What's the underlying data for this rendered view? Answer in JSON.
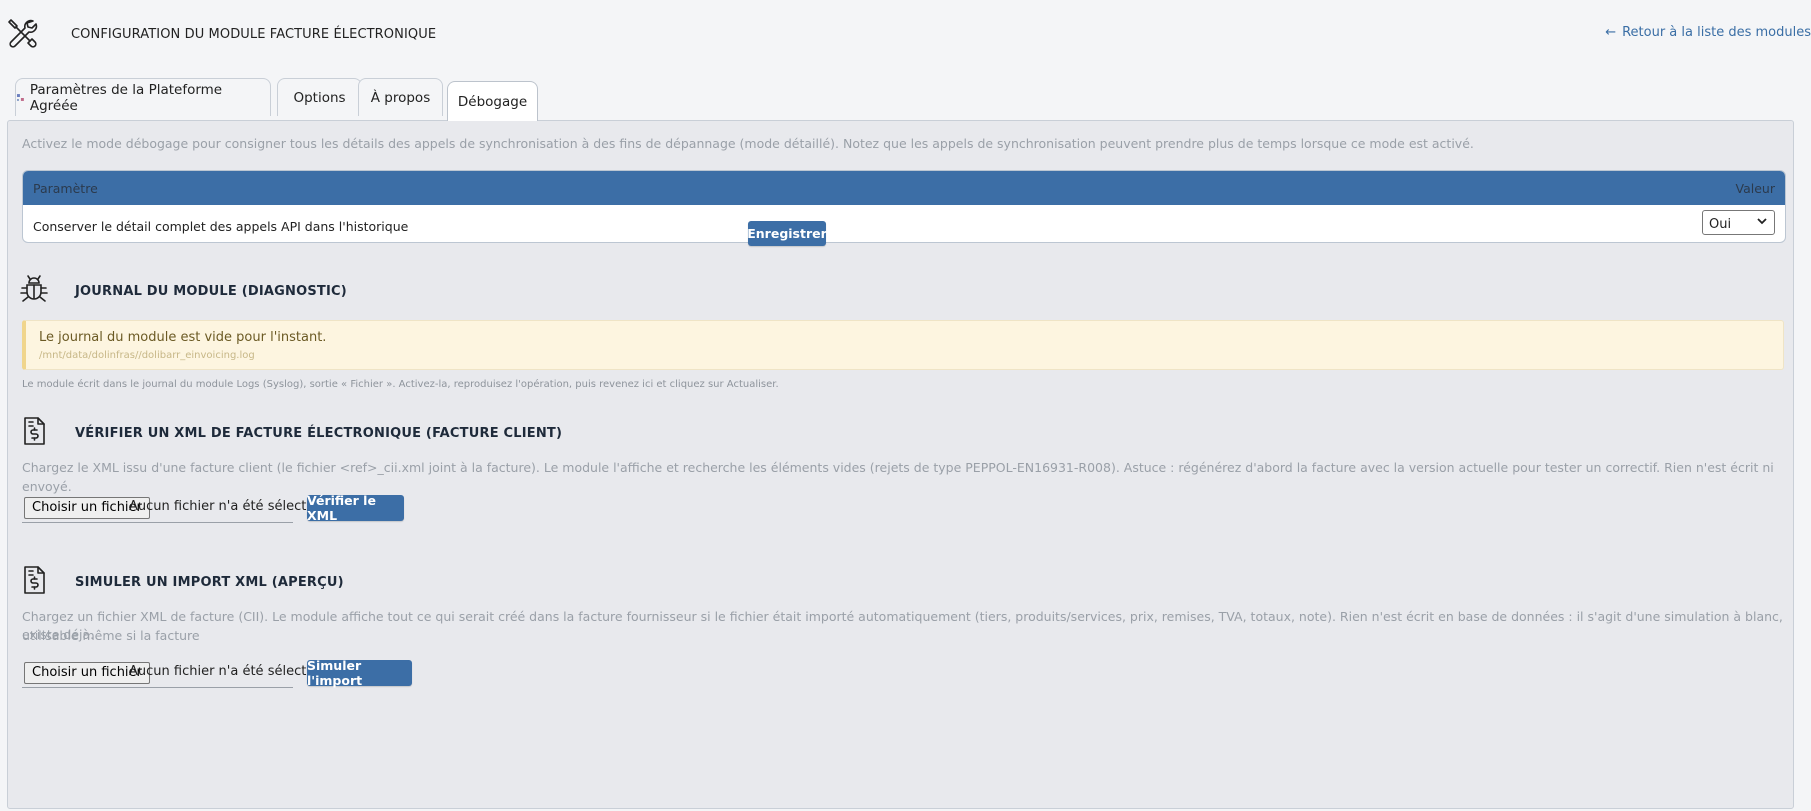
{
  "header": {
    "title": "CONFIGURATION DU MODULE FACTURE ÉLECTRONIQUE",
    "back_link": "Retour à la liste des modules"
  },
  "tabs": [
    {
      "label": "Paramètres de la Plateforme Agréée",
      "active": false
    },
    {
      "label": "Options",
      "active": false
    },
    {
      "label": "À propos",
      "active": false
    },
    {
      "label": "Débogage",
      "active": true
    }
  ],
  "debug": {
    "intro": "Activez le mode débogage pour consigner tous les détails des appels de synchronisation à des fins de dépannage (mode détaillé). Notez que les appels de synchronisation peuvent prendre plus de temps lorsque ce mode est activé.",
    "table": {
      "col_param": "Paramètre",
      "col_value": "Valeur",
      "rows": [
        {
          "label": "Conserver le détail complet des appels API dans l'historique",
          "value": "Oui"
        }
      ]
    },
    "save_label": "Enregistrer"
  },
  "journal": {
    "title": "JOURNAL DU MODULE (DIAGNOSTIC)",
    "empty_msg": "Le journal du module est vide pour l'instant.",
    "path": "/mnt/data/dolinfras//dolibarr_einvoicing.log",
    "note": "Le module écrit dans le journal du module Logs (Syslog), sortie « Fichier ». Activez-la, reproduisez l'opération, puis revenez ici et cliquez sur Actualiser."
  },
  "verify": {
    "title": "VÉRIFIER UN XML DE FACTURE ÉLECTRONIQUE (FACTURE CLIENT)",
    "desc": "Chargez le XML issu d'une facture client (le fichier <ref>_cii.xml joint à la facture). Le module l'affiche et recherche les éléments vides (rejets de type PEPPOL-EN16931-R008). Astuce : régénérez d'abord la facture avec la version actuelle pour tester un correctif. Rien n'est écrit ni envoyé.",
    "file_button": "Choisir un fichier",
    "file_status": "Aucun fichier n'a été sélectionné",
    "submit_label": "Vérifier le XML"
  },
  "simulate": {
    "title": "SIMULER UN IMPORT XML (APERÇU)",
    "desc_line1": "Chargez un fichier XML de facture (CII). Le module affiche tout ce qui serait créé dans la facture fournisseur si le fichier était importé automatiquement (tiers, produits/services, prix, remises, TVA, totaux, note). Rien n'est écrit en base de données : il s'agit d'une simulation à blanc, utilisable même si la facture",
    "desc_line2": "existe déjà.",
    "file_button": "Choisir un fichier",
    "file_status": "Aucun fichier n'a été sélectionné",
    "submit_label": "Simuler l'import"
  },
  "colors": {
    "accent": "#3c6ea6",
    "panel_bg": "#e8e9ed",
    "notice_bg": "#fdf5e0"
  },
  "icons": {
    "header": "tools-icon",
    "back": "arrow-left-icon",
    "journal": "bug-icon",
    "verify": "invoice-dollar-icon",
    "simulate": "invoice-dollar-icon"
  }
}
